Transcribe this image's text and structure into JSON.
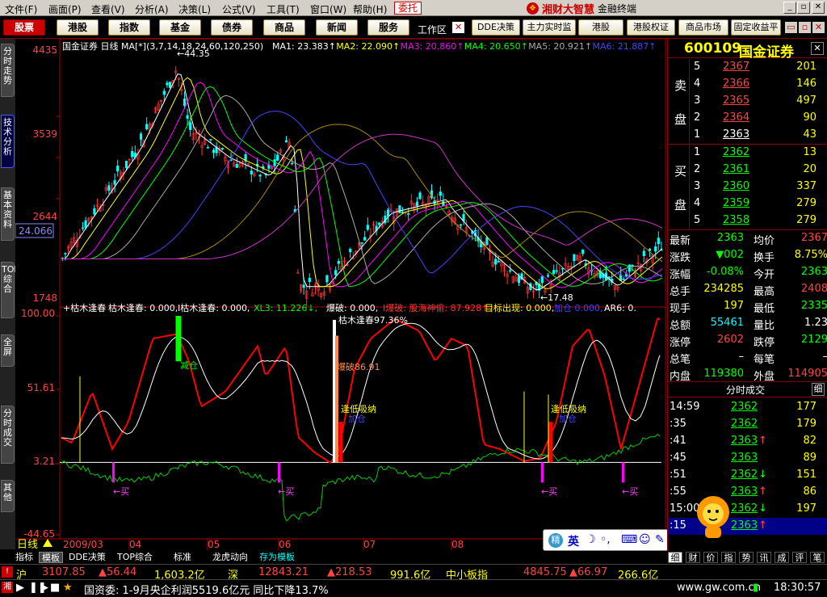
{
  "menu": [
    "文件(F)",
    "画面(P)",
    "查看(V)",
    "分析(A)",
    "决策(L)",
    "公式(V)",
    "工具(T)",
    "窗口(W)",
    "帮助(H)"
  ],
  "weituo": "委托",
  "brand": {
    "name": "湘财大智慧",
    "sub": "金融终端",
    "logo": "❖"
  },
  "toolbar": {
    "buttons": [
      "股票",
      "港股",
      "指数",
      "基金",
      "债券",
      "商品",
      "新闻",
      "服务"
    ],
    "workarea": "工作区",
    "right_buttons": [
      "DDE决策",
      "主力实时监",
      "港股",
      "港股权证",
      "商品市场",
      "固定收益平"
    ]
  },
  "left_tabs": [
    "分时走势",
    "技术分析",
    "基本资料",
    "TOP综合",
    "全屏",
    "分时成交",
    "其他"
  ],
  "chart": {
    "header": "国金证券 日线 MA[*](3,7,14,18,24,60,120,250)",
    "ma_items": [
      {
        "label": "MA1:",
        "value": "23.383↑",
        "color": "#ffffff"
      },
      {
        "label": "MA2:",
        "value": "22.090↑",
        "color": "#ffff00"
      },
      {
        "label": "MA3:",
        "value": "20.860↑",
        "color": "#ff00ff"
      },
      {
        "label": "MA4:",
        "value": "20.650↑",
        "color": "#00ff00"
      },
      {
        "label": "MA5:",
        "value": "20.921↑",
        "color": "#aaaaaa"
      },
      {
        "label": "MA6:",
        "value": "21.887↑",
        "color": "#4444ff"
      }
    ],
    "price_axis": [
      "4435",
      "3539",
      "2644",
      "1748"
    ],
    "current_price_label": "24.066",
    "high_label": "44.35",
    "low_label": "17.48",
    "ind_header_left": "+枯木逢春",
    "ind_items": [
      {
        "label": "枯木逢春:",
        "value": "0.000,",
        "color": "#ffffff"
      },
      {
        "label": "I枯木逢春:",
        "value": "0.000,",
        "color": "#ffffff"
      },
      {
        "label": "XL3:",
        "value": "11.226↓,",
        "color": "#00ff00"
      },
      {
        "label": "爆破:",
        "value": "0.000,",
        "color": "#ffffff"
      },
      {
        "label": "I爆破:",
        "value": "股海神偷: 87.928↑,",
        "color": "#ff3333"
      },
      {
        "label": "目标出现:",
        "value": "0.000,",
        "color": "#ffff00"
      },
      {
        "label": "加仓",
        "value": "0.000,",
        "color": "#4444ff"
      },
      {
        "label": "AR6:",
        "value": "0.",
        "color": "#ffffff"
      }
    ],
    "ind_axis": [
      "100.00",
      "51.61",
      "3.21",
      "-44.65"
    ],
    "annotations": {
      "jiancang": "减仓",
      "kumu": "枯木逢春97.36%",
      "baopo": "爆破86.91",
      "fengdi1": "逢低吸纳",
      "jiacang1": "加仓",
      "fengdi2": "逢低吸纳",
      "jiacang2": "加仓",
      "mai": "←买"
    },
    "dates": [
      "2009/03",
      "04",
      "05",
      "06",
      "07",
      "08"
    ],
    "period_label": "日线"
  },
  "quote": {
    "code": "600109",
    "name": "国金证券",
    "sell": [
      {
        "lvl": "5",
        "price": "2367",
        "vol": "201"
      },
      {
        "lvl": "4",
        "price": "2366",
        "vol": "146"
      },
      {
        "lvl": "3",
        "price": "2365",
        "vol": "497"
      },
      {
        "lvl": "2",
        "price": "2364",
        "vol": "90"
      },
      {
        "lvl": "1",
        "price": "2363",
        "vol": "43"
      }
    ],
    "buy": [
      {
        "lvl": "1",
        "price": "2362",
        "vol": "13"
      },
      {
        "lvl": "2",
        "price": "2361",
        "vol": "20"
      },
      {
        "lvl": "3",
        "price": "2360",
        "vol": "337"
      },
      {
        "lvl": "4",
        "price": "2359",
        "vol": "279"
      },
      {
        "lvl": "5",
        "price": "2358",
        "vol": "279"
      }
    ],
    "sell_label": [
      "卖",
      "盘"
    ],
    "buy_label": [
      "买",
      "盘"
    ],
    "stats": [
      {
        "l1": "最新",
        "v1": "2363",
        "c1": "num-g",
        "l2": "均价",
        "v2": "2367",
        "c2": "num-r"
      },
      {
        "l1": "涨跌",
        "v1": "▼002",
        "c1": "num-g",
        "l2": "换手",
        "v2": "8.75%",
        "c2": "num-y"
      },
      {
        "l1": "涨幅",
        "v1": "-0.08%",
        "c1": "num-g",
        "l2": "今开",
        "v2": "2363",
        "c2": "num-g"
      },
      {
        "l1": "总手",
        "v1": "234285",
        "c1": "num-y",
        "l2": "最高",
        "v2": "2408",
        "c2": "num-r"
      },
      {
        "l1": "现手",
        "v1": "197",
        "c1": "num-y",
        "l2": "最低",
        "v2": "2335",
        "c2": "num-g"
      },
      {
        "l1": "总额",
        "v1": "55461",
        "c1": "num-c",
        "l2": "量比",
        "v2": "1.23",
        "c2": "num-w"
      },
      {
        "l1": "涨停",
        "v1": "2602",
        "c1": "num-r",
        "l2": "跌停",
        "v2": "2129",
        "c2": "num-g"
      },
      {
        "l1": "总笔",
        "v1": "–",
        "c1": "num-w",
        "l2": "每笔",
        "v2": "–",
        "c2": "num-w"
      },
      {
        "l1": "内盘",
        "v1": "119380",
        "c1": "num-g",
        "l2": "外盘",
        "v2": "114905",
        "c2": "num-r"
      }
    ],
    "ticks_title": "分时成交",
    "ticks_btn": "细",
    "ticks": [
      {
        "t": "14:59",
        "p": "2362",
        "a": "",
        "v": "177"
      },
      {
        "t": ":35",
        "p": "2362",
        "a": "",
        "v": "179"
      },
      {
        "t": ":41",
        "p": "2363",
        "a": "↑",
        "v": "82"
      },
      {
        "t": ":45",
        "p": "2363",
        "a": "",
        "v": "89"
      },
      {
        "t": ":51",
        "p": "2362",
        "a": "↓",
        "v": "151"
      },
      {
        "t": ":55",
        "p": "2363",
        "a": "↑",
        "v": "86"
      },
      {
        "t": "15:00",
        "p": "2362",
        "a": "↓",
        "v": "197"
      },
      {
        "t": ":15",
        "p": "2363",
        "a": "↑",
        "v": ""
      }
    ]
  },
  "right_bottom_tabs": [
    "细",
    "财",
    "价",
    "指",
    "势",
    "讯",
    "成",
    "评",
    "笔"
  ],
  "bottom_tabs": [
    "指标",
    "模板",
    "DDE决策",
    "TOP综合",
    "标准",
    "龙虎动向",
    "存为模板"
  ],
  "status1": {
    "market": "沪",
    "v1": "3107.85",
    "v2": "56.44",
    "v3": "1,603.2亿",
    "market2": "深",
    "v4": "12843.21",
    "v5": "218.53",
    "v6": "991.6亿",
    "board": "中小板指",
    "v7": "4845.75",
    "v8": "66.97",
    "v9": "266.6亿"
  },
  "status2": {
    "news": "国资委: 1-9月央企利润5519.6亿元 同比下降13.7%",
    "url": "www.gw.com.cn",
    "time": "18:30:57",
    "ime_label": "精"
  }
}
